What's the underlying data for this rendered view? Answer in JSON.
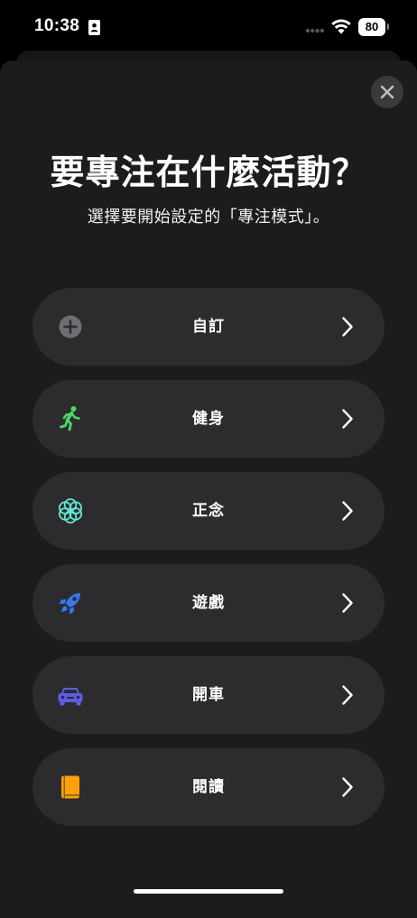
{
  "status_bar": {
    "time": "10:38",
    "battery": "80"
  },
  "sheet": {
    "title": "要專注在什麼活動？",
    "subtitle": "選擇要開始設定的「專注模式」。"
  },
  "options": [
    {
      "label": "自訂",
      "icon": "plus-circle-icon",
      "color": "#6e6e73"
    },
    {
      "label": "健身",
      "icon": "running-figure-icon",
      "color": "#4cd964"
    },
    {
      "label": "正念",
      "icon": "flower-icon",
      "color": "#63e6d2"
    },
    {
      "label": "遊戲",
      "icon": "rocket-icon",
      "color": "#3478f6"
    },
    {
      "label": "開車",
      "icon": "car-icon",
      "color": "#5e5ce6"
    },
    {
      "label": "閱讀",
      "icon": "book-icon",
      "color": "#ff9f0a"
    }
  ]
}
